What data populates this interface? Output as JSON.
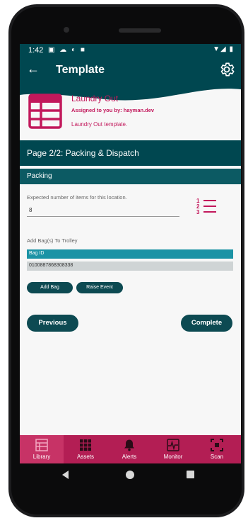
{
  "status_bar": {
    "time": "1:42",
    "left_icons": "▣ ☁ ◐ ■",
    "right_icons": "▼◢ ▮"
  },
  "app_bar": {
    "title": "Template",
    "back_icon": "arrow-left-icon",
    "settings_icon": "gear-icon"
  },
  "template_header": {
    "title": "Laundry Out",
    "assigned": "Assigned to you by: hayman.dev",
    "description": "Laundry Out template.",
    "icon": "table-icon",
    "accent_color": "#c2185b"
  },
  "page_bar": {
    "label": "Page 2/2: Packing & Dispatch"
  },
  "section": {
    "label": "Packing"
  },
  "expected_items": {
    "label": "Expected number of items for this location.",
    "value": "8",
    "icon": "numbered-list-icon"
  },
  "bags": {
    "label": "Add Bag(s) To Trolley",
    "column_header": "Bag ID",
    "rows": [
      "0100887868308338"
    ],
    "add_button": "Add Bag",
    "raise_button": "Raise Event"
  },
  "navigation": {
    "previous": "Previous",
    "complete": "Complete"
  },
  "bottom_nav": {
    "items": [
      {
        "label": "Library",
        "icon": "library-icon",
        "active": true
      },
      {
        "label": "Assets",
        "icon": "assets-grid-icon",
        "active": false
      },
      {
        "label": "Alerts",
        "icon": "bell-icon",
        "active": false
      },
      {
        "label": "Monitor",
        "icon": "monitor-icon",
        "active": false
      },
      {
        "label": "Scan",
        "icon": "scan-icon",
        "active": false
      }
    ]
  },
  "colors": {
    "primary": "#004750",
    "accent": "#b31e54",
    "table_header": "#1b93a5"
  }
}
